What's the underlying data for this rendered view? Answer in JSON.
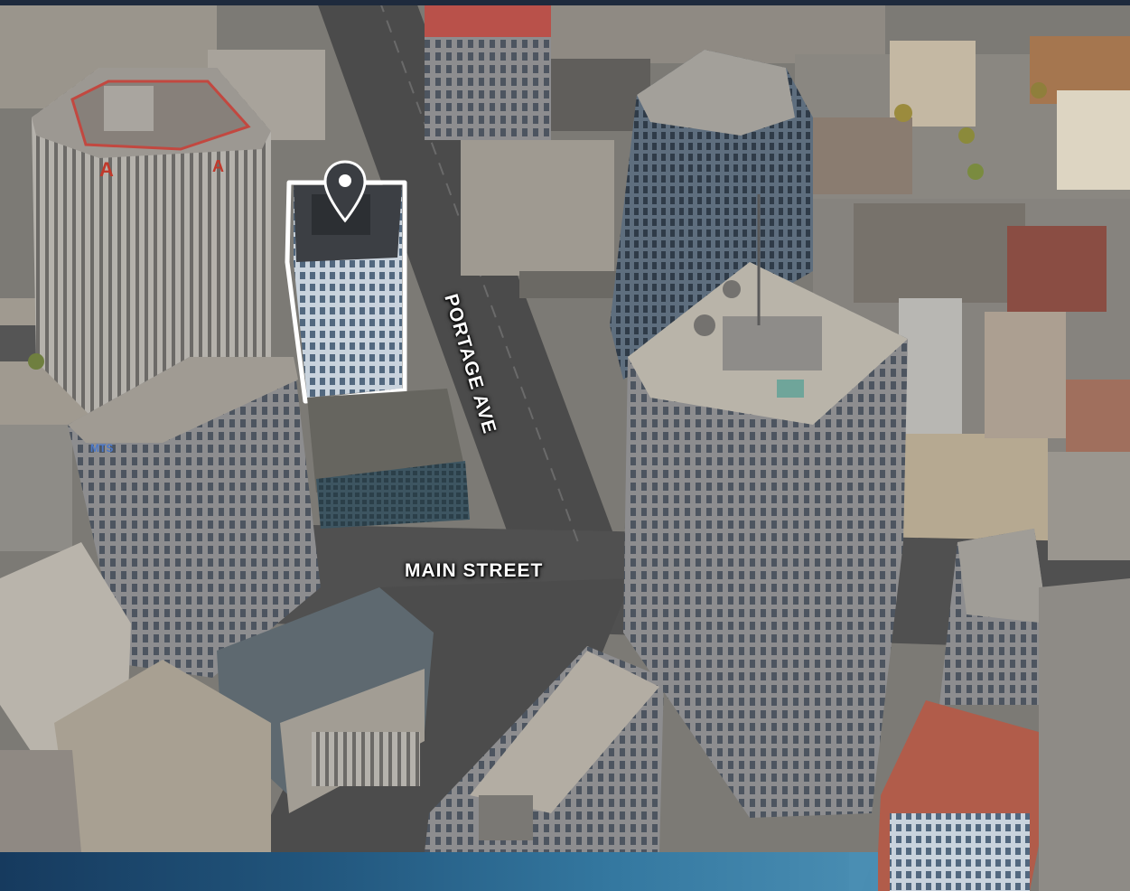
{
  "map": {
    "labels": {
      "portage": "PORTAGE AVE",
      "main": "MAIN STREET"
    },
    "marker": {
      "icon": "location-pin-icon",
      "color": "#3a3d42",
      "outline_color": "#ffffff"
    }
  },
  "colors": {
    "band_start": "#163a5e",
    "band_end": "#4a8eb3",
    "road": "#4a4a4a"
  }
}
